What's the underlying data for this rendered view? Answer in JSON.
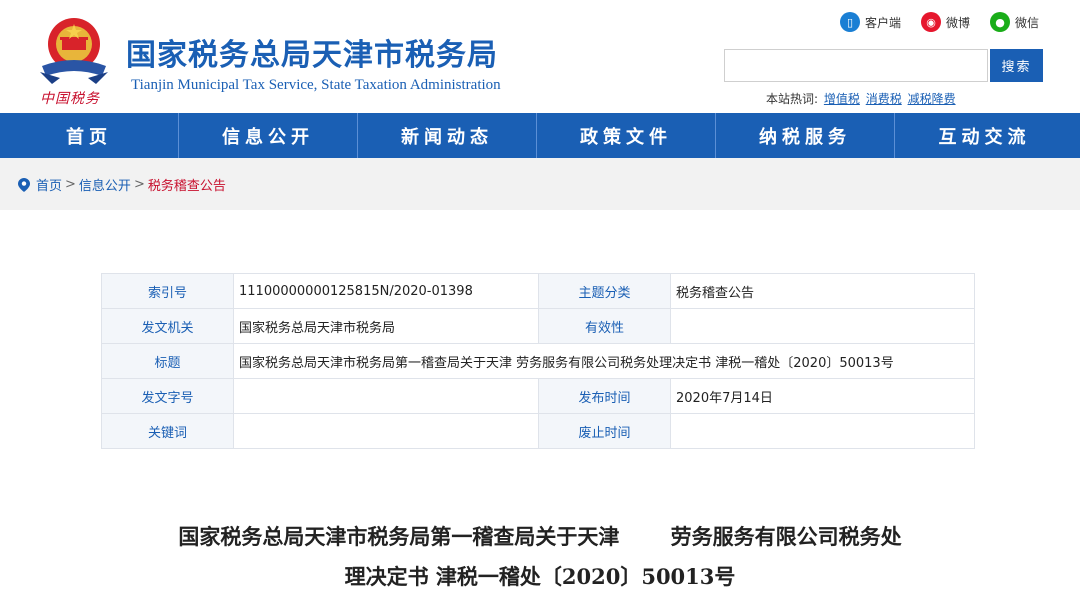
{
  "header": {
    "title": "国家税务总局天津市税务局",
    "subtitle": "Tianjin Municipal Tax Service, State Taxation Administration",
    "motto": "中国税务",
    "social": [
      {
        "label": "客户端",
        "icon": "mobile-icon",
        "color": "#1a7fd4"
      },
      {
        "label": "微博",
        "icon": "weibo-icon",
        "color": "#e6162d"
      },
      {
        "label": "微信",
        "icon": "wechat-icon",
        "color": "#1aad19"
      }
    ],
    "search": {
      "placeholder": "",
      "button": "搜索"
    },
    "hot": {
      "label": "本站热词:",
      "items": [
        "增值税",
        "消费税",
        "减税降费"
      ]
    }
  },
  "nav": [
    "首页",
    "信息公开",
    "新闻动态",
    "政策文件",
    "纳税服务",
    "互动交流"
  ],
  "breadcrumb": [
    "首页",
    "信息公开",
    "税务稽查公告"
  ],
  "meta": {
    "index_label": "索引号",
    "index_value": "11100000000125815N/2020-01398",
    "topic_label": "主题分类",
    "topic_value": "税务稽查公告",
    "issuer_label": "发文机关",
    "issuer_value": "国家税务总局天津市税务局",
    "validity_label": "有效性",
    "validity_value": "",
    "title_label": "标题",
    "title_value": "国家税务总局天津市税务局第一稽查局关于天津       劳务服务有限公司税务处理决定书 津税一稽处〔2020〕50013号",
    "docno_label": "发文字号",
    "docno_value": "",
    "pubdate_label": "发布时间",
    "pubdate_value": "2020年7月14日",
    "keywords_label": "关键词",
    "keywords_value": "",
    "expire_label": "废止时间",
    "expire_value": ""
  },
  "document": {
    "title_line1": "国家税务总局天津市税务局第一稽查局关于天津       劳务服务有限公司税务处",
    "title_line2": "理决定书 津税一稽处〔2020〕50013号"
  },
  "colors": {
    "brand": "#1a5fb4",
    "accent_red": "#c8102e",
    "nav_bg": "#1a5fb4"
  }
}
